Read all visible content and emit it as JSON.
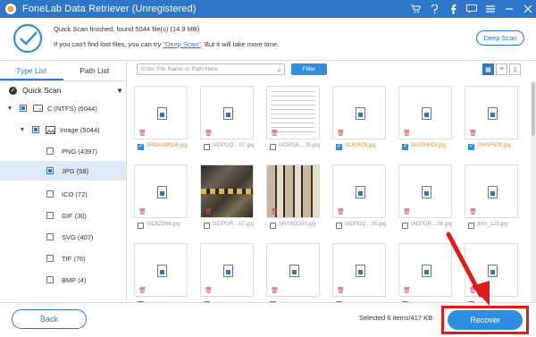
{
  "titlebar": {
    "title": "FoneLab Data Retriever (Unregistered)",
    "icons": [
      "cart-icon",
      "question-icon",
      "facebook-icon",
      "chat-icon",
      "menu-icon",
      "minimize-icon",
      "close-icon"
    ]
  },
  "scan": {
    "status": "Quick Scan finished, found 5044 file(s) (14.9 MB)",
    "hint_prefix": "If you can't find lost files, you can try",
    "hint_link": "\"Deep Scan\"",
    "hint_suffix": ". But it will take more time.",
    "deep_scan_label": "Deep Scan"
  },
  "sidebar": {
    "tabs": [
      {
        "label": "Type List",
        "active": true
      },
      {
        "label": "Path List",
        "active": false
      }
    ],
    "quick_scan_label": "Quick Scan",
    "drive_label": "C:(NTFS) (5044)",
    "image_label": "Image (5044)",
    "types": [
      {
        "label": "PNG (4397)",
        "selected": false
      },
      {
        "label": "JPG (58)",
        "selected": true
      },
      {
        "label": "ICO (72)",
        "selected": false
      },
      {
        "label": "GIF (30)",
        "selected": false
      },
      {
        "label": "SVG (407)",
        "selected": false
      },
      {
        "label": "TIF (76)",
        "selected": false
      },
      {
        "label": "BMP (4)",
        "selected": false
      }
    ]
  },
  "toolbar": {
    "search_placeholder": "Enter File Name or Path Here",
    "filter_label": "Filter"
  },
  "files": [
    {
      "name": "SR9AAWN35.jpg",
      "checked": true,
      "thumb": "icon"
    },
    {
      "name": "IADPGQ....07.jpg",
      "checked": false,
      "thumb": "icon"
    },
    {
      "name": "IADPGR....35.jpg",
      "checked": false,
      "thumb": "docs"
    },
    {
      "name": "SLRVIC5.jpg",
      "checked": true,
      "thumb": "icon"
    },
    {
      "name": "SIGRNHDI.jpg",
      "checked": true,
      "thumb": "icon"
    },
    {
      "name": "SIHSF67K.jpg",
      "checked": true,
      "thumb": "icon"
    },
    {
      "name": "SIC6Z8N6.jpg",
      "checked": false,
      "thumb": "icon"
    },
    {
      "name": "IADPGR....07.jpg",
      "checked": false,
      "thumb": "stone"
    },
    {
      "name": "SRX8OG00.jpg",
      "checked": false,
      "thumb": "tiles"
    },
    {
      "name": "IADPGQ....95.jpg",
      "checked": false,
      "thumb": "icon"
    },
    {
      "name": "IADPGR....36.jpg",
      "checked": false,
      "thumb": "icon"
    },
    {
      "name": "dmn_120.jpg",
      "checked": false,
      "thumb": "icon"
    },
    {
      "name": "",
      "checked": false,
      "thumb": "icon"
    },
    {
      "name": "",
      "checked": false,
      "thumb": "icon"
    },
    {
      "name": "",
      "checked": false,
      "thumb": "icon"
    },
    {
      "name": "",
      "checked": false,
      "thumb": "icon"
    },
    {
      "name": "",
      "checked": false,
      "thumb": "icon"
    },
    {
      "name": "",
      "checked": false,
      "thumb": "icon"
    }
  ],
  "bottom": {
    "back_label": "Back",
    "selected_info": "Selected 6 items/417 KB",
    "recover_label": "Recover"
  },
  "colors": {
    "accent": "#2e77c8",
    "button_blue": "#2e8fe0",
    "highlight_red": "#e01b1b",
    "checked_name": "#e08a1e"
  }
}
